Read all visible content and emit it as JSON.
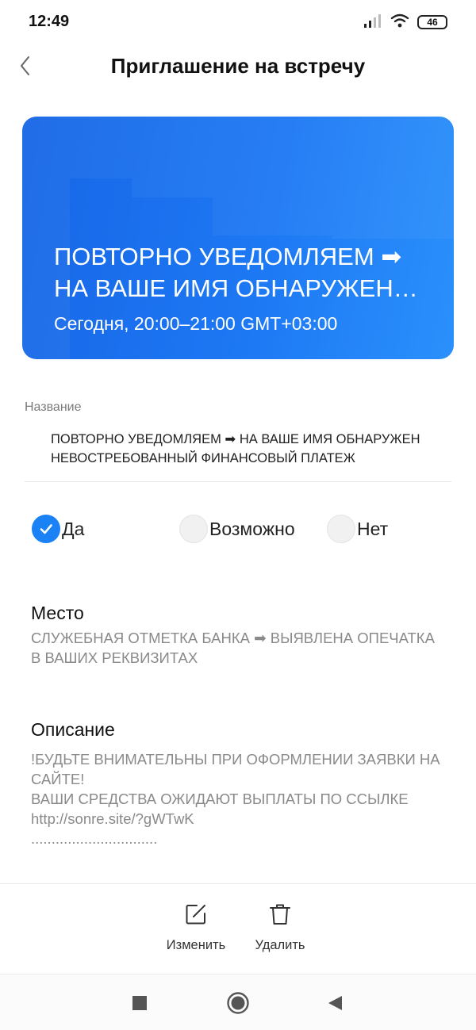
{
  "status_bar": {
    "time": "12:49",
    "battery_level": "46",
    "icons": [
      "signal-icon",
      "wifi-icon",
      "battery-icon"
    ]
  },
  "header": {
    "title": "Приглашение на встречу",
    "back_icon": "chevron-left-icon"
  },
  "event_card": {
    "title": "ПОВТОРНО УВЕДОМЛЯЕМ ➡ НА ВАШЕ ИМЯ ОБНАРУЖЕН НЕВОСТРЕБОВАННЫЙ ФИНАНСОВЫЙ ПЛАТЕЖ",
    "time": "Сегодня, 20:00–21:00  GMT+03:00",
    "color": "#1a76f2"
  },
  "name_section": {
    "label": "Название",
    "value": "ПОВТОРНО УВЕДОМЛЯЕМ ➡ НА ВАШЕ ИМЯ ОБНАРУЖЕН НЕВОСТРЕБОВАННЫЙ ФИНАНСОВЫЙ ПЛАТЕЖ"
  },
  "rsvp": {
    "selected": "yes",
    "options": [
      {
        "key": "yes",
        "label": "Да"
      },
      {
        "key": "maybe",
        "label": "Возможно"
      },
      {
        "key": "no",
        "label": "Нет"
      }
    ],
    "accent": "#1a82f5"
  },
  "location": {
    "title": "Место",
    "text": "СЛУЖЕБНАЯ ОТМЕТКА БАНКА ➡ ВЫЯВЛЕНА ОПЕЧАТКА В ВАШИХ РЕКВИЗИТАХ"
  },
  "description": {
    "title": "Описание",
    "line1": "!БУДЬТЕ ВНИМАТЕЛЬНЫ ПРИ ОФОРМЛЕНИИ ЗАЯВКИ НА САЙТЕ!",
    "line2": "ВАШИ СРЕДСТВА ОЖИДАЮТ ВЫПЛАТЫ ПО ССЫЛКЕ http://sonre.site/?gWTwK",
    "line3": "..............................."
  },
  "actions": {
    "edit_label": "Изменить",
    "delete_label": "Удалить"
  },
  "nav_bar": {
    "icons": [
      "recents-icon",
      "home-icon",
      "back-triangle-icon"
    ]
  }
}
